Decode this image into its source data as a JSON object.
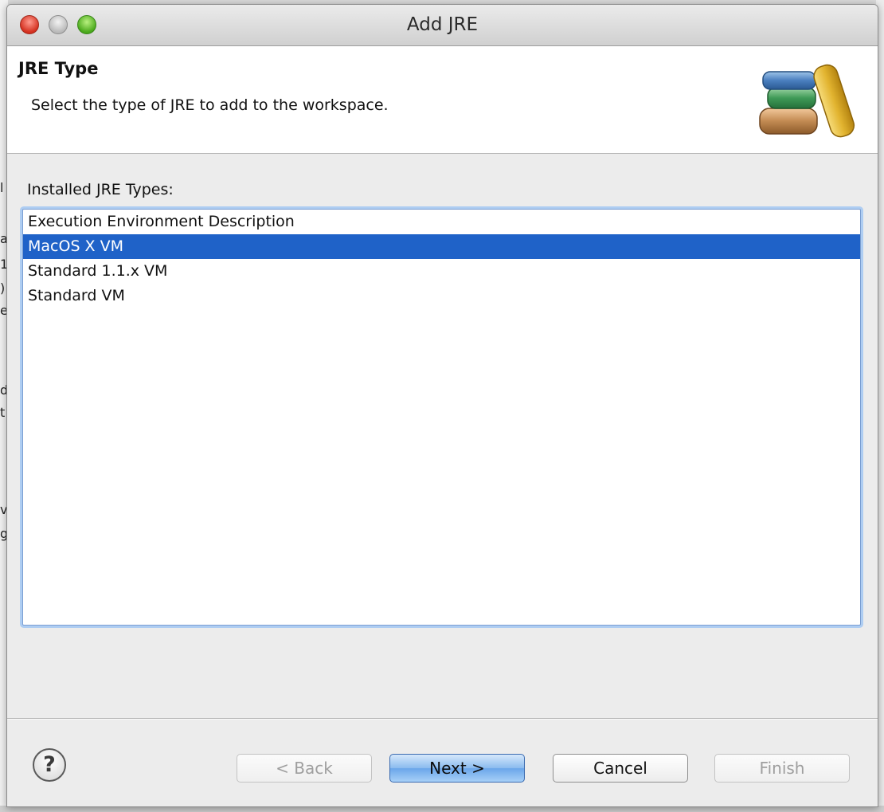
{
  "window": {
    "title": "Add JRE"
  },
  "banner": {
    "heading": "JRE Type",
    "description": "Select the type of JRE to add to the workspace.",
    "icon": "jre-books-icon"
  },
  "content": {
    "list_label": "Installed JRE Types:",
    "items": [
      {
        "label": "Execution Environment Description",
        "selected": false
      },
      {
        "label": "MacOS X VM",
        "selected": true
      },
      {
        "label": "Standard 1.1.x VM",
        "selected": false
      },
      {
        "label": "Standard VM",
        "selected": false
      }
    ]
  },
  "footer": {
    "help_glyph": "?",
    "back_label": "< Back",
    "next_label": "Next >",
    "cancel_label": "Cancel",
    "finish_label": "Finish"
  },
  "colors": {
    "selection": "#1f62c8",
    "default_button": "#6aa6ea",
    "close": "#d4301f",
    "maximize": "#4aa91b"
  }
}
